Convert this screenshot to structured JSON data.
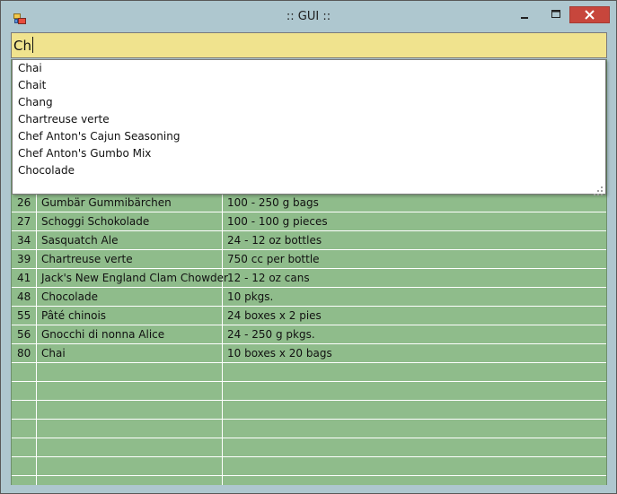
{
  "window": {
    "title": ":: GUI ::"
  },
  "search": {
    "value": "Ch"
  },
  "autocomplete": {
    "items": [
      "Chai",
      "Chait",
      "Chang",
      "Chartreuse verte",
      "Chef Anton's Cajun Seasoning",
      "Chef Anton's Gumbo Mix",
      "Chocolade"
    ]
  },
  "grid": {
    "rows": [
      {
        "id": "26",
        "name": "Gumbär Gummibärchen",
        "qty": "100 - 250 g bags"
      },
      {
        "id": "27",
        "name": "Schoggi Schokolade",
        "qty": "100 - 100 g pieces"
      },
      {
        "id": "34",
        "name": "Sasquatch Ale",
        "qty": "24 - 12 oz bottles"
      },
      {
        "id": "39",
        "name": "Chartreuse verte",
        "qty": "750 cc per bottle"
      },
      {
        "id": "41",
        "name": "Jack's New England Clam Chowder",
        "qty": "12 - 12 oz cans"
      },
      {
        "id": "48",
        "name": "Chocolade",
        "qty": "10 pkgs."
      },
      {
        "id": "55",
        "name": "Pâté chinois",
        "qty": "24 boxes x 2 pies"
      },
      {
        "id": "56",
        "name": "Gnocchi di nonna Alice",
        "qty": "24 - 250 g pkgs."
      },
      {
        "id": "80",
        "name": "Chai",
        "qty": "10 boxes x 20 bags"
      }
    ]
  },
  "colors": {
    "window_bg": "#aec7cf",
    "grid_bg": "#8fbc8b",
    "search_bg": "#f0e38e",
    "close_button": "#c7463c"
  }
}
